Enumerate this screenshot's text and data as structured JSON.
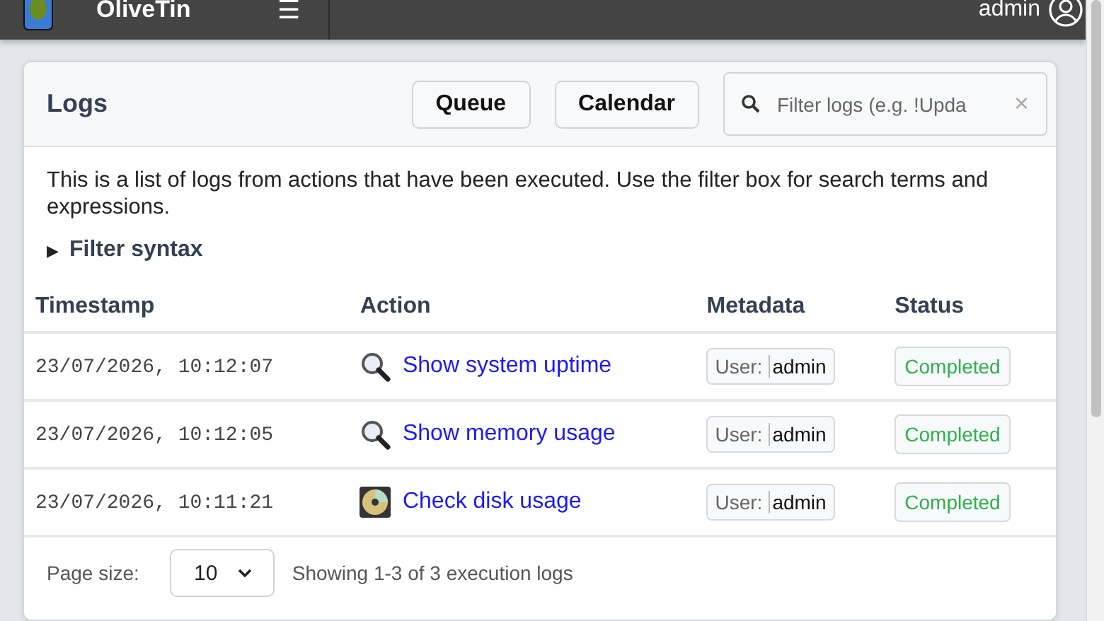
{
  "header": {
    "app_name": "OliveTin",
    "menu_glyph": "☰",
    "user": "admin"
  },
  "card": {
    "title": "Logs",
    "buttons": [
      "Queue",
      "Calendar"
    ],
    "search": {
      "placeholder": "Filter logs (e.g. !Upda",
      "clear_glyph": "×"
    }
  },
  "description": "This is a list of logs from actions that have been executed. Use the filter box for search terms and expressions.",
  "filter_syntax": {
    "marker": "▶",
    "label": "Filter syntax",
    "expanded": false
  },
  "table": {
    "columns": [
      "Timestamp",
      "Action",
      "Metadata",
      "Status"
    ],
    "rows": [
      {
        "timestamp": "23/07/2026, 10:12:07",
        "kind": "magnifier",
        "action": "Show system uptime",
        "meta_key": "User:",
        "meta_value": "admin",
        "status": "Completed"
      },
      {
        "timestamp": "23/07/2026, 10:12:05",
        "kind": "magnifier",
        "action": "Show memory usage",
        "meta_key": "User:",
        "meta_value": "admin",
        "status": "Completed"
      },
      {
        "timestamp": "23/07/2026, 10:11:21",
        "kind": "disc",
        "action": "Check disk usage",
        "meta_key": "User:",
        "meta_value": "admin",
        "status": "Completed"
      }
    ]
  },
  "pagination": {
    "page_size_label": "Page size:",
    "page_size": "10",
    "summary": "Showing 1-3 of 3 execution logs"
  }
}
